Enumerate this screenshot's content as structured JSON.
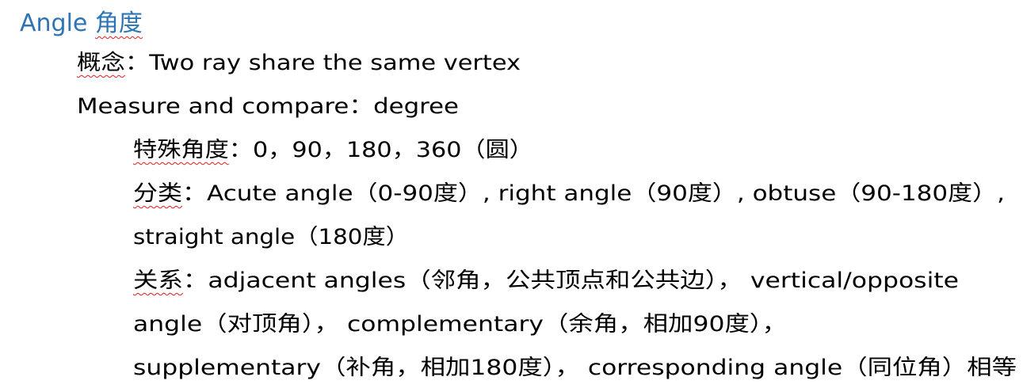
{
  "heading": {
    "latin": "Angle ",
    "cjk": "角度"
  },
  "lines": {
    "definition": {
      "label": "概念",
      "text": "：Two ray share the same vertex"
    },
    "measure": {
      "text": "Measure and compare：degree"
    },
    "special": {
      "label": "特殊角度",
      "text": "：0，90，180，360（圆）"
    },
    "classification": {
      "label": "分类",
      "text": "：Acute angle（0-90度）, right angle（90度）, obtuse（90-180度）,"
    },
    "classification_cont": {
      "text": "straight angle（180度）"
    },
    "relations": {
      "label": "关系",
      "text": "：adjacent angles（邻角，公共顶点和公共边）， vertical/opposite"
    },
    "relations_cont1": {
      "text": "angle（对顶角）， complementary（余角，相加90度），"
    },
    "relations_cont2": {
      "text": "supplementary（补角，相加180度）， corresponding angle（同位角）相等"
    }
  },
  "colors": {
    "heading": "#2e74b5",
    "body_text": "#000000",
    "spellcheck_underline": "#e02020"
  }
}
